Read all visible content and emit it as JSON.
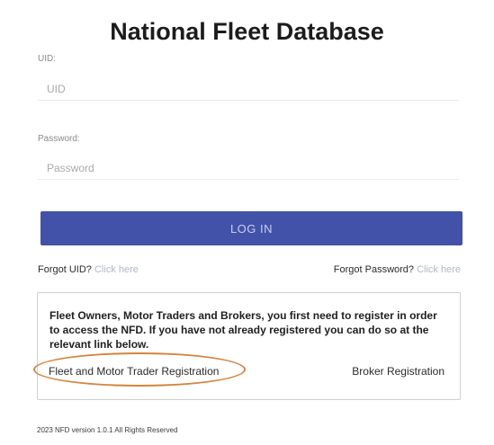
{
  "header": {
    "title": "National Fleet Database"
  },
  "form": {
    "uid_label": "UID:",
    "uid_placeholder": "UID",
    "password_label": "Password:",
    "password_placeholder": "Password",
    "login_label": "LOG IN"
  },
  "forgot": {
    "uid_text": "Forgot UID?",
    "uid_link": "Click here",
    "password_text": "Forgot Password?",
    "password_link": "Click here"
  },
  "info": {
    "message": "Fleet Owners, Motor Traders and Brokers, you first need to register in order to access the NFD. If you have not already registered you can do so at the relevant link below.",
    "fleet_registration": "Fleet and Motor Trader Registration",
    "broker_registration": "Broker Registration"
  },
  "footer": {
    "text": "2023 NFD version 1.0.1 All Rights Reserved"
  },
  "colors": {
    "button": "#4152a8",
    "highlight": "#d4843d",
    "link": "#aeb7c8"
  }
}
